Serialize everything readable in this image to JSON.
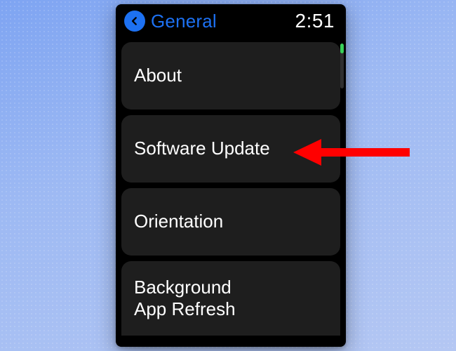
{
  "header": {
    "title": "General",
    "time": "2:51"
  },
  "menu": {
    "items": [
      {
        "label": "About"
      },
      {
        "label": "Software Update"
      },
      {
        "label": "Orientation"
      },
      {
        "label": "Background\nApp Refresh"
      }
    ]
  },
  "annotation": {
    "target_index": 1
  },
  "colors": {
    "accent": "#1d71f2",
    "row_bg": "#1e1e1e",
    "scroll_thumb": "#38d158",
    "arrow": "#ff0000"
  }
}
